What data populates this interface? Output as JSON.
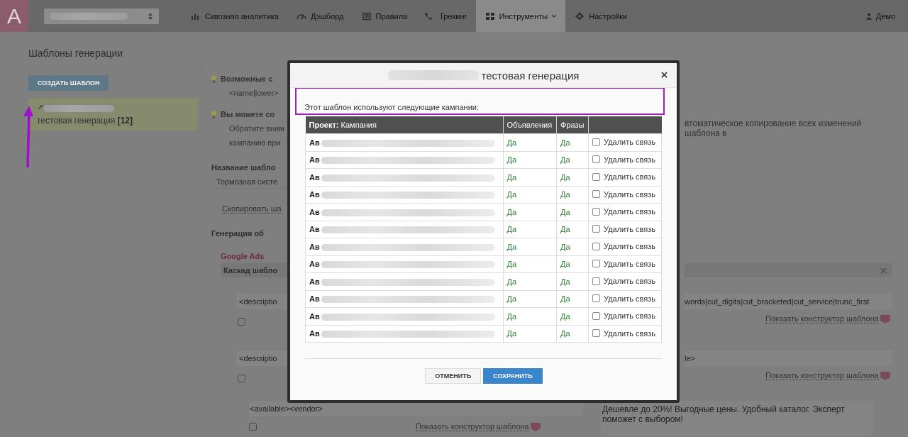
{
  "nav": {
    "logo": "A",
    "tabs": [
      {
        "label": "Сквозная аналитика",
        "selected": false,
        "has_menu": false
      },
      {
        "label": "Дэшборд",
        "selected": false,
        "has_menu": false
      },
      {
        "label": "Правила",
        "selected": false,
        "has_menu": false
      },
      {
        "label": "Трекинг",
        "selected": false,
        "has_menu": false
      },
      {
        "label": "Инструменты",
        "selected": true,
        "has_menu": true
      },
      {
        "label": "Настройки",
        "selected": false,
        "has_menu": false
      }
    ],
    "user": "Демо"
  },
  "page_title": "Шаблоны генерации",
  "sidebar": {
    "create_button": "СОЗДАТЬ ШАБЛОН",
    "items": [
      {
        "label": "тестовая генерация",
        "count": "[12]",
        "selected": true
      }
    ]
  },
  "content": {
    "rows": [
      {
        "kind": "hint",
        "left": "Возможные с"
      },
      {
        "kind": "note",
        "left": "<name|lower>"
      },
      {
        "kind": "hint",
        "left": "Вы можете со"
      },
      {
        "kind": "note",
        "left": "Обратите вним",
        "right": "втоматическое копирование всех изменений шаблона в"
      },
      {
        "kind": "note",
        "left": "кампанию при"
      },
      {
        "kind": "heading",
        "left": "Название шабло"
      },
      {
        "kind": "field",
        "left": "Тормозная систе"
      },
      {
        "kind": "link",
        "left": "Скопировать ша"
      },
      {
        "kind": "heading",
        "left": "Генерация об"
      },
      {
        "kind": "tag",
        "left": "Google Ads"
      },
      {
        "kind": "panel",
        "left": "Каскад шабло"
      },
      {
        "kind": "code",
        "left": "<descriptio",
        "right": "words|cut_digits|cut_bracketed|cut_service|trunc_first"
      },
      {
        "kind": "check",
        "checked": false,
        "right": "Показать конструктор шаблона"
      },
      {
        "kind": "code",
        "left": "<descriptio",
        "right": "le>"
      },
      {
        "kind": "check",
        "checked": false,
        "right": "Показать конструктор шаблона"
      }
    ],
    "bottom": {
      "code": "<available><vendor>",
      "checked": false,
      "link": "Показать конструктор шаблона",
      "preview": "Дешевле до 20%! Выгодные цены. Удобный каталог. Эксперт поможет с выбором!"
    }
  },
  "modal": {
    "title": "тестовая генерация",
    "message": "Этот шаблон используют следующие кампании:",
    "columns": [
      {
        "bold": "Проект:",
        "label": "Кампания"
      },
      {
        "label": "Объявления"
      },
      {
        "label": "Фразы"
      }
    ],
    "rows": [
      {
        "project": "Ав",
        "ads": "Да",
        "phrases": "Да",
        "action": "Удалить связь",
        "checked": false
      },
      {
        "project": "Ав",
        "ads": "Да",
        "phrases": "Да",
        "action": "Удалить связь",
        "checked": false
      },
      {
        "project": "Ав",
        "ads": "Да",
        "phrases": "Да",
        "action": "Удалить связь",
        "checked": false
      },
      {
        "project": "Ав",
        "ads": "Да",
        "phrases": "Да",
        "action": "Удалить связь",
        "checked": false
      },
      {
        "project": "Ав",
        "ads": "Да",
        "phrases": "Да",
        "action": "Удалить связь",
        "checked": false
      },
      {
        "project": "Ав",
        "ads": "Да",
        "phrases": "Да",
        "action": "Удалить связь",
        "checked": false
      },
      {
        "project": "Ав",
        "ads": "Да",
        "phrases": "Да",
        "action": "Удалить связь",
        "checked": false
      },
      {
        "project": "Ав",
        "ads": "Да",
        "phrases": "Да",
        "action": "Удалить связь",
        "checked": false
      },
      {
        "project": "Ав",
        "ads": "Да",
        "phrases": "Да",
        "action": "Удалить связь",
        "checked": false
      },
      {
        "project": "Ав",
        "ads": "Да",
        "phrases": "Да",
        "action": "Удалить связь",
        "checked": false
      },
      {
        "project": "Ав",
        "ads": "Да",
        "phrases": "Да",
        "action": "Удалить связь",
        "checked": false
      },
      {
        "project": "Ав",
        "ads": "Да",
        "phrases": "Да",
        "action": "Удалить связь",
        "checked": false
      }
    ],
    "buttons": {
      "cancel": "ОТМЕНИТЬ",
      "save": "СОХРАНИТЬ"
    }
  }
}
